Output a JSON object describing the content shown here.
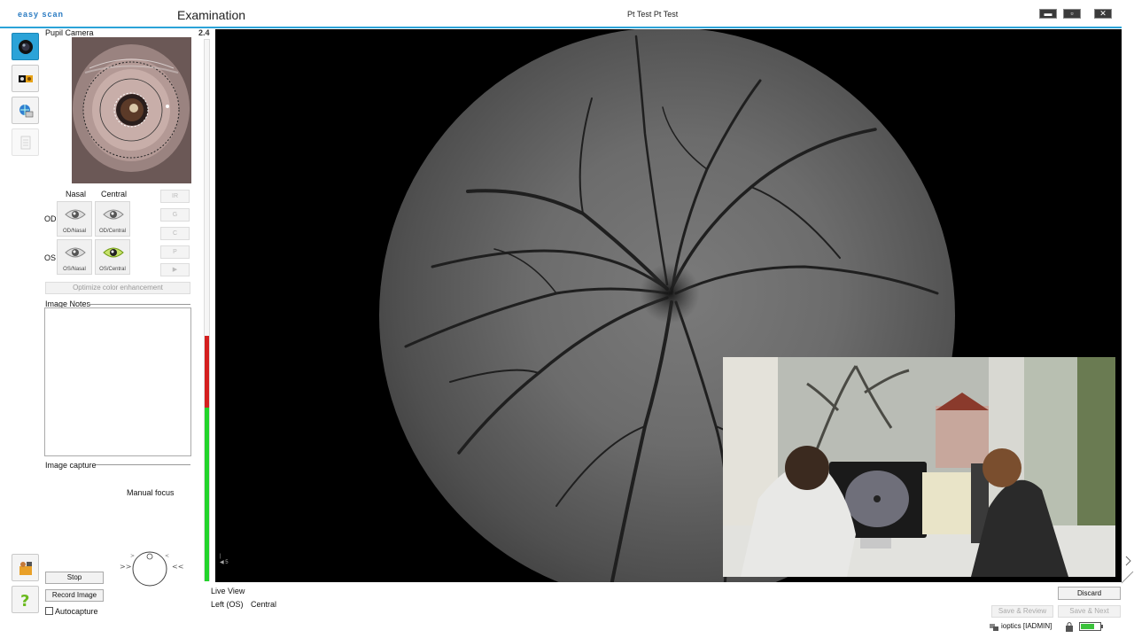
{
  "app": {
    "logo": "easy scan",
    "title": "Examination",
    "patient": "Pt Test Pt Test",
    "version": "2.4"
  },
  "left_tools": [
    {
      "icon": "camera-lens-icon",
      "active": true
    },
    {
      "icon": "image-compare-icon",
      "active": false
    },
    {
      "icon": "network-icon",
      "active": false
    },
    {
      "icon": "clipboard-icon",
      "active": false
    }
  ],
  "pupil_camera": {
    "label": "Pupil Camera"
  },
  "field_selector": {
    "col_nasal": "Nasal",
    "col_central": "Central",
    "row_od": "OD",
    "row_os": "OS",
    "od_nasal": "OD/Nasal",
    "od_central": "OD/Central",
    "os_nasal": "OS/Nasal",
    "os_central": "OS/Central",
    "selected": "OS/Central"
  },
  "channels": [
    "IR",
    "G",
    "C",
    "P",
    "▶"
  ],
  "optimize_button": "Optimize color enhancement",
  "image_notes": {
    "label": "Image Notes",
    "value": ""
  },
  "image_capture": {
    "label": "Image capture",
    "focus_mode": "Manual focus",
    "stop": "Stop",
    "record": "Record Image",
    "autocapture": "Autocapture",
    "autocapture_checked": false
  },
  "viewer": {
    "mode": "Live View",
    "eye": "Left (OS)",
    "field": "Central"
  },
  "actions": {
    "discard": "Discard",
    "save_review": "Save & Review",
    "save_next": "Save & Next"
  },
  "status": {
    "user": "ioptics [IADMIN]"
  },
  "colors": {
    "accent": "#2ba3d8",
    "meter_red": "#d41f1f",
    "meter_green": "#22d42b",
    "selected_eye": "#8ab81c"
  }
}
